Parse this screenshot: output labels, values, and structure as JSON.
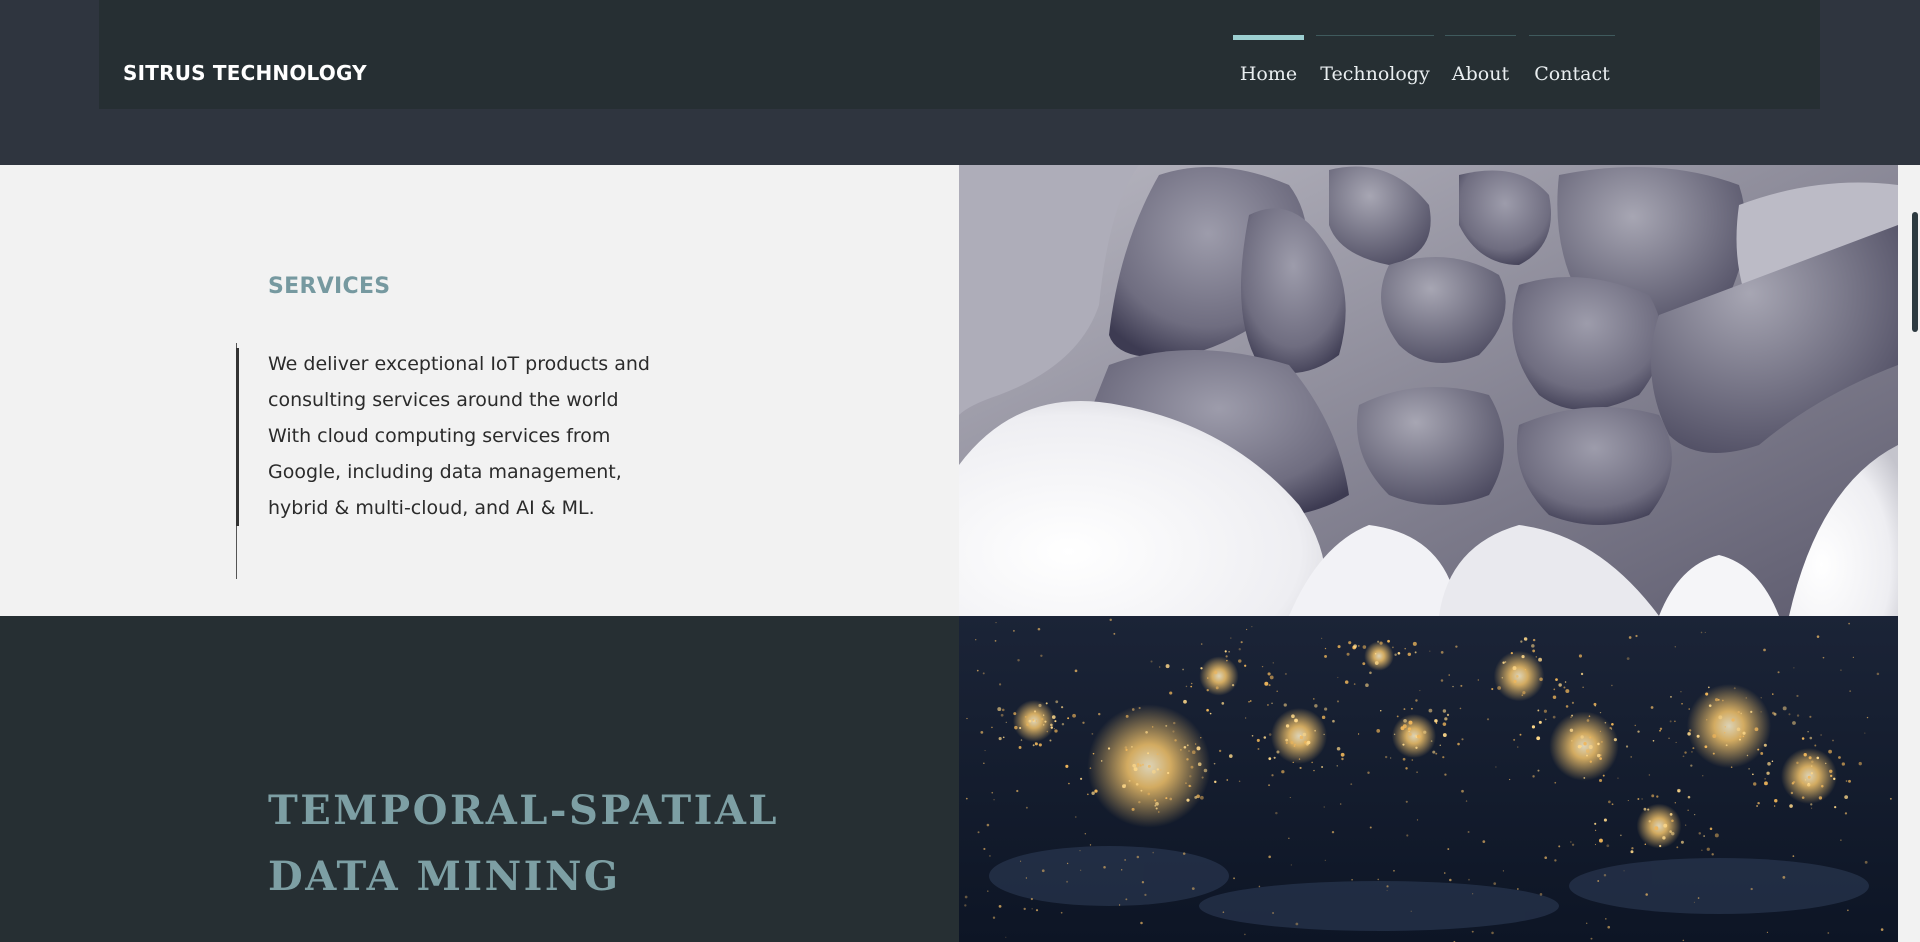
{
  "header": {
    "logo_text": "SITRUS TECHNOLOGY",
    "nav": [
      {
        "label": "Home",
        "active": true
      },
      {
        "label": "Technology",
        "active": false
      },
      {
        "label": "About",
        "active": false
      },
      {
        "label": "Contact",
        "active": false
      }
    ]
  },
  "services": {
    "title": "SERVICES",
    "lines": [
      "We deliver exceptional IoT products and",
      "consulting services around the world",
      "With cloud computing services from",
      "Google, including data management,",
      "hybrid & multi-cloud, and AI & ML."
    ]
  },
  "temporal_spatial": {
    "heading_line1": "TEMPORAL-SPATIAL",
    "heading_line2": "DATA MINING"
  },
  "colors": {
    "header_bg": "#262f33",
    "page_bg": "#2f353f",
    "accent": "#9ccfd1",
    "section_title": "#7699a0",
    "light_panel": "#f2f2f2"
  }
}
